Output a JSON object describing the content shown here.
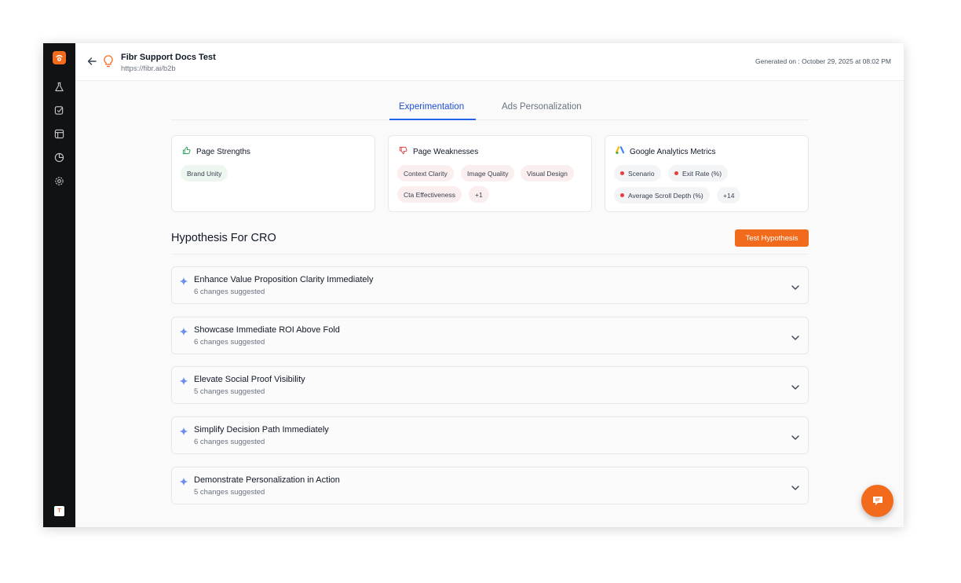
{
  "header": {
    "title": "Fibr Support Docs Test",
    "url": "https://fibr.ai/b2b",
    "generated": "Generated on : October 29, 2025 at 08:02 PM"
  },
  "sidebar": {
    "items": [
      "experiments-icon",
      "tasks-icon",
      "layout-icon",
      "analytics-icon",
      "settings-icon"
    ],
    "avatar": "T"
  },
  "tabs": [
    {
      "label": "Experimentation",
      "active": true
    },
    {
      "label": "Ads Personalization",
      "active": false
    }
  ],
  "cards": {
    "strengths": {
      "title": "Page Strengths",
      "chips": [
        "Brand Unity"
      ]
    },
    "weaknesses": {
      "title": "Page Weaknesses",
      "chips": [
        "Context Clarity",
        "Image Quality",
        "Visual Design",
        "Cta Effectiveness",
        "+1"
      ]
    },
    "analytics": {
      "title": "Google Analytics Metrics",
      "chips": [
        "Scenario",
        "Exit Rate (%)",
        "Average Scroll Depth (%)",
        "+14"
      ]
    }
  },
  "hypothesis": {
    "title": "Hypothesis For CRO",
    "button": "Test Hypothesis",
    "items": [
      {
        "title": "Enhance Value Proposition Clarity Immediately",
        "sub": "6 changes suggested"
      },
      {
        "title": "Showcase Immediate ROI Above Fold",
        "sub": "6 changes suggested"
      },
      {
        "title": "Elevate Social Proof Visibility",
        "sub": "5 changes suggested"
      },
      {
        "title": "Simplify Decision Path Immediately",
        "sub": "6 changes suggested"
      },
      {
        "title": "Demonstrate Personalization in Action",
        "sub": "5 changes suggested"
      }
    ]
  },
  "colors": {
    "accent": "#f26b1d",
    "tab_active": "#2563eb",
    "sidebar": "#111214"
  }
}
